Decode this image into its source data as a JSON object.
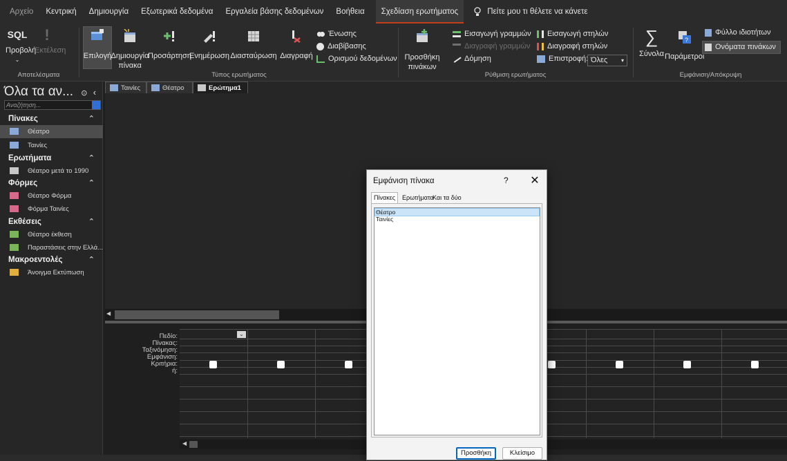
{
  "menu": {
    "tabs": [
      "Αρχείο",
      "Κεντρική",
      "Δημιουργία",
      "Εξωτερικά δεδομένα",
      "Εργαλεία βάσης δεδομένων",
      "Βοήθεια",
      "Σχεδίαση ερωτήματος"
    ],
    "active_tab": "Σχεδίαση ερωτήματος",
    "tell_me": "Πείτε μου τι θέλετε να κάνετε"
  },
  "ribbon": {
    "view": "Προβολή",
    "run": "Εκτέλεση",
    "sql": "SQL",
    "results_group": "Αποτελέσματα",
    "select": "Επιλογή",
    "make_table_1": "Δημιουργία",
    "make_table_2": "πίνακα",
    "append": "Προσάρτηση",
    "update": "Ενημέρωση",
    "crosstab": "Διασταύρωση",
    "delete": "Διαγραφή",
    "union": "Ένωσης",
    "pass_through": "Διαβίβασης",
    "data_definition": "Ορισμού δεδομένων",
    "query_type_group": "Τύπος ερωτήματος",
    "add_tables_1": "Προσθήκη",
    "add_tables_2": "πινάκων",
    "insert_rows": "Εισαγωγή γραμμών",
    "delete_rows": "Διαγραφή γραμμών",
    "builder": "Δόμηση",
    "insert_columns": "Εισαγωγή στηλών",
    "delete_columns": "Διαγραφή στηλών",
    "return": "Επιστροφή:",
    "return_value": "Όλες",
    "setup_group": "Ρύθμιση ερωτήματος",
    "totals": "Σύνολα",
    "parameters": "Παράμετροι",
    "property_sheet": "Φύλλο ιδιοτήτων",
    "table_names": "Ονόματα πινάκων",
    "show_hide_group": "Εμφάνιση/Απόκρυψη"
  },
  "nav": {
    "title": "Όλα τα αν...",
    "search_placeholder": "Αναζήτηση...",
    "categories": [
      {
        "label": "Πίνακες",
        "items": [
          "Θέατρο",
          "Ταινίες"
        ]
      },
      {
        "label": "Ερωτήματα",
        "items": [
          "Θέατρο μετά το 1990"
        ]
      },
      {
        "label": "Φόρμες",
        "items": [
          "Θέατρο Φόρμα",
          "Φόρμα Ταινίες"
        ]
      },
      {
        "label": "Εκθέσεις",
        "items": [
          "Θέατρο έκθεση",
          "Παραστάσεις στην Ελλά..."
        ]
      },
      {
        "label": "Μακροεντολές",
        "items": [
          "Άνοιγμα Εκτύπωση"
        ]
      }
    ],
    "selected_item": "Θέατρο"
  },
  "doctabs": [
    "Ταινίες",
    "Θέατρο",
    "Ερώτημα1"
  ],
  "grid": {
    "row_labels": [
      "Πεδίο:",
      "Πίνακας:",
      "Ταξινόμηση:",
      "Εμφάνιση:",
      "Κριτήρια:",
      "ή:"
    ]
  },
  "dialog": {
    "title": "Εμφάνιση πίνακα",
    "help": "?",
    "close": "✕",
    "tabs": [
      "Πίνακες",
      "Ερωτήματα",
      "Και τα δύο"
    ],
    "items": [
      "Θέατρο",
      "Ταινίες"
    ],
    "selected_item": "Θέατρο",
    "add_button": "Προσθήκη",
    "close_button": "Κλείσιμο"
  },
  "colors": {
    "accent": "#c43e1c",
    "background": "#1f1f1f",
    "selection": "#cce4f7"
  }
}
